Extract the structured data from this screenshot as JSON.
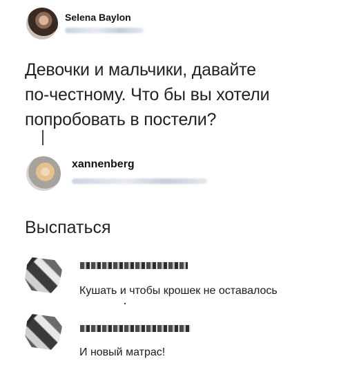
{
  "tweet": {
    "author_name": "Selena Baylon",
    "text_lines": [
      "Девочки и мальчики, давайте",
      "по-честному. Что бы вы хотели",
      "попробовать в постели?"
    ]
  },
  "reply": {
    "author_name": "xannenberg",
    "text": "Выспаться"
  },
  "comments": [
    {
      "text": "Кушать и чтобы крошек не оставалось"
    },
    {
      "text": "И новый матрас!"
    }
  ]
}
